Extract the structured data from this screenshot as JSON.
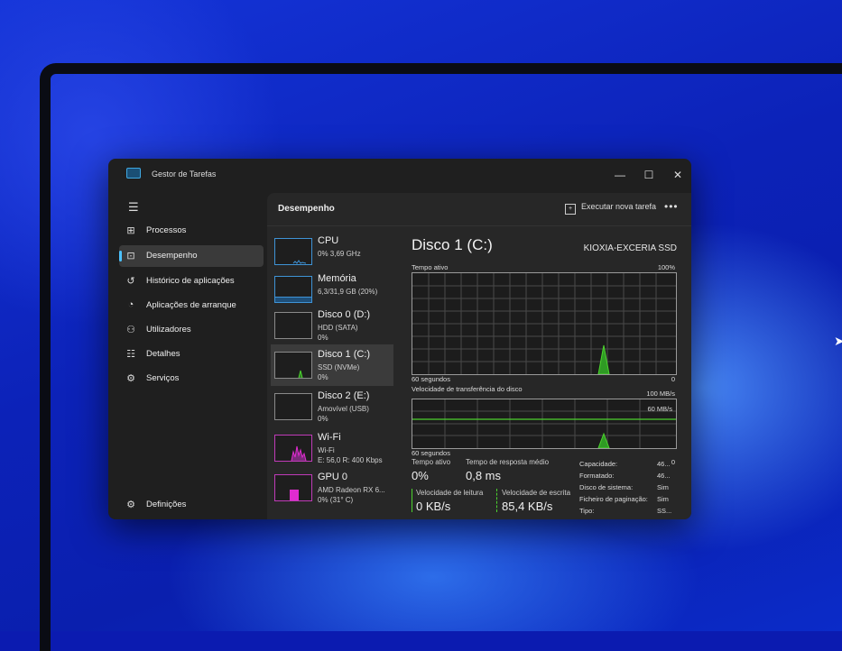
{
  "window": {
    "title": "Gestor de Tarefas",
    "minimize": "—",
    "maximize": "☐",
    "close": "✕"
  },
  "sidebar": {
    "menu_icon": "hamburger-icon",
    "items": [
      {
        "label": "Processos",
        "icon": "grid-icon"
      },
      {
        "label": "Desempenho",
        "icon": "performance-icon",
        "selected": true
      },
      {
        "label": "Histórico de aplicações",
        "icon": "history-icon"
      },
      {
        "label": "Aplicações de arranque",
        "icon": "startup-icon"
      },
      {
        "label": "Utilizadores",
        "icon": "users-icon"
      },
      {
        "label": "Detalhes",
        "icon": "list-icon"
      },
      {
        "label": "Serviços",
        "icon": "services-icon"
      }
    ],
    "settings": {
      "label": "Definições",
      "icon": "gear-icon"
    }
  },
  "main": {
    "title": "Desempenho",
    "run_task": "Executar nova tarefa",
    "more": "•••"
  },
  "devices": [
    {
      "name": "CPU",
      "line2": "0%  3,69 GHz",
      "line3": ""
    },
    {
      "name": "Memória",
      "line2": "6,3/31,9 GB (20%)",
      "line3": ""
    },
    {
      "name": "Disco 0 (D:)",
      "line2": "HDD (SATA)",
      "line3": "0%"
    },
    {
      "name": "Disco 1 (C:)",
      "line2": "SSD (NVMe)",
      "line3": "0%",
      "selected": true
    },
    {
      "name": "Disco 2 (E:)",
      "line2": "Amovível (USB)",
      "line3": "0%"
    },
    {
      "name": "Wi-Fi",
      "line2": "Wi-Fi",
      "line3": "E: 56,0  R: 400 Kbps"
    },
    {
      "name": "GPU 0",
      "line2": "AMD Radeon RX 6...",
      "line3": "0% (31° C)"
    }
  ],
  "detail": {
    "title": "Disco 1 (C:)",
    "model": "KIOXIA-EXCERIA SSD",
    "active_time_label": "Tempo ativo",
    "active_time_max": "100%",
    "active_time_span": "60 segundos",
    "active_time_min": "0",
    "transfer_label": "Velocidade de transferência do disco",
    "transfer_max": "100 MB/s",
    "transfer_mid": "60 MB/s",
    "transfer_span": "60 segundos",
    "transfer_min": "0",
    "stats": {
      "active_time": {
        "label": "Tempo ativo",
        "value": "0%"
      },
      "response": {
        "label": "Tempo de resposta médio",
        "value": "0,8 ms"
      },
      "read": {
        "label": "Velocidade de leitura",
        "value": "0 KB/s"
      },
      "write": {
        "label": "Velocidade de escrita",
        "value": "85,4 KB/s"
      }
    },
    "properties": [
      {
        "key": "Capacidade:",
        "value": "46..."
      },
      {
        "key": "Formatado:",
        "value": "46..."
      },
      {
        "key": "Disco de sistema:",
        "value": "Sim"
      },
      {
        "key": "Ficheiro de paginação:",
        "value": "Sim"
      },
      {
        "key": "Tipo:",
        "value": "SS..."
      }
    ]
  },
  "colors": {
    "accent": "#4cc2ff",
    "disk_graph": "#4cd32e",
    "wifi_graph": "#e02bd0"
  }
}
